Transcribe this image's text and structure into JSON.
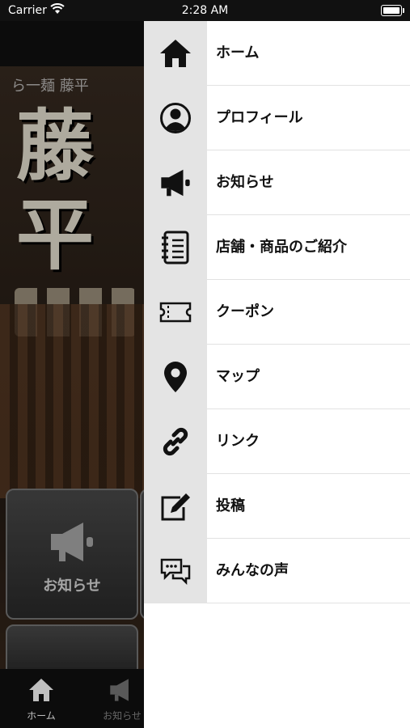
{
  "status_bar": {
    "carrier": "Carrier",
    "time": "2:28 AM"
  },
  "background": {
    "shop_name": "ら一麺 藤平",
    "logo_text": "藤平",
    "tiles": [
      {
        "label": "お知らせ"
      }
    ],
    "tabbar": [
      {
        "label": "ホーム"
      },
      {
        "label": "お知らせ"
      }
    ]
  },
  "menu": {
    "items": [
      {
        "label": "ホーム",
        "icon": "home-icon"
      },
      {
        "label": "プロフィール",
        "icon": "profile-icon"
      },
      {
        "label": "お知らせ",
        "icon": "megaphone-icon"
      },
      {
        "label": "店舗・商品のご紹介",
        "icon": "notebook-icon"
      },
      {
        "label": "クーポン",
        "icon": "ticket-icon"
      },
      {
        "label": "マップ",
        "icon": "map-pin-icon"
      },
      {
        "label": "リンク",
        "icon": "link-icon"
      },
      {
        "label": "投稿",
        "icon": "edit-icon"
      },
      {
        "label": "みんなの声",
        "icon": "chat-bubbles-icon"
      }
    ]
  },
  "colors": {
    "drawer_bg": "#ffffff",
    "icon_column": "#e4e4e4",
    "text": "#111111"
  }
}
